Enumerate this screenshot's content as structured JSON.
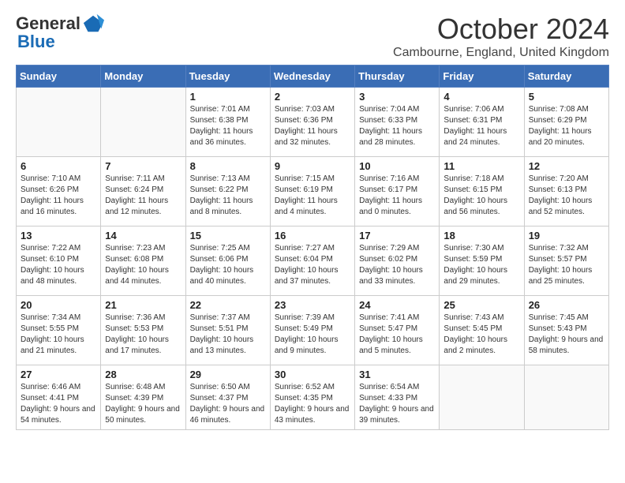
{
  "logo": {
    "general": "General",
    "blue": "Blue"
  },
  "header": {
    "month_year": "October 2024",
    "location": "Cambourne, England, United Kingdom"
  },
  "days_of_week": [
    "Sunday",
    "Monday",
    "Tuesday",
    "Wednesday",
    "Thursday",
    "Friday",
    "Saturday"
  ],
  "weeks": [
    [
      {
        "day": "",
        "info": ""
      },
      {
        "day": "",
        "info": ""
      },
      {
        "day": "1",
        "info": "Sunrise: 7:01 AM\nSunset: 6:38 PM\nDaylight: 11 hours and 36 minutes."
      },
      {
        "day": "2",
        "info": "Sunrise: 7:03 AM\nSunset: 6:36 PM\nDaylight: 11 hours and 32 minutes."
      },
      {
        "day": "3",
        "info": "Sunrise: 7:04 AM\nSunset: 6:33 PM\nDaylight: 11 hours and 28 minutes."
      },
      {
        "day": "4",
        "info": "Sunrise: 7:06 AM\nSunset: 6:31 PM\nDaylight: 11 hours and 24 minutes."
      },
      {
        "day": "5",
        "info": "Sunrise: 7:08 AM\nSunset: 6:29 PM\nDaylight: 11 hours and 20 minutes."
      }
    ],
    [
      {
        "day": "6",
        "info": "Sunrise: 7:10 AM\nSunset: 6:26 PM\nDaylight: 11 hours and 16 minutes."
      },
      {
        "day": "7",
        "info": "Sunrise: 7:11 AM\nSunset: 6:24 PM\nDaylight: 11 hours and 12 minutes."
      },
      {
        "day": "8",
        "info": "Sunrise: 7:13 AM\nSunset: 6:22 PM\nDaylight: 11 hours and 8 minutes."
      },
      {
        "day": "9",
        "info": "Sunrise: 7:15 AM\nSunset: 6:19 PM\nDaylight: 11 hours and 4 minutes."
      },
      {
        "day": "10",
        "info": "Sunrise: 7:16 AM\nSunset: 6:17 PM\nDaylight: 11 hours and 0 minutes."
      },
      {
        "day": "11",
        "info": "Sunrise: 7:18 AM\nSunset: 6:15 PM\nDaylight: 10 hours and 56 minutes."
      },
      {
        "day": "12",
        "info": "Sunrise: 7:20 AM\nSunset: 6:13 PM\nDaylight: 10 hours and 52 minutes."
      }
    ],
    [
      {
        "day": "13",
        "info": "Sunrise: 7:22 AM\nSunset: 6:10 PM\nDaylight: 10 hours and 48 minutes."
      },
      {
        "day": "14",
        "info": "Sunrise: 7:23 AM\nSunset: 6:08 PM\nDaylight: 10 hours and 44 minutes."
      },
      {
        "day": "15",
        "info": "Sunrise: 7:25 AM\nSunset: 6:06 PM\nDaylight: 10 hours and 40 minutes."
      },
      {
        "day": "16",
        "info": "Sunrise: 7:27 AM\nSunset: 6:04 PM\nDaylight: 10 hours and 37 minutes."
      },
      {
        "day": "17",
        "info": "Sunrise: 7:29 AM\nSunset: 6:02 PM\nDaylight: 10 hours and 33 minutes."
      },
      {
        "day": "18",
        "info": "Sunrise: 7:30 AM\nSunset: 5:59 PM\nDaylight: 10 hours and 29 minutes."
      },
      {
        "day": "19",
        "info": "Sunrise: 7:32 AM\nSunset: 5:57 PM\nDaylight: 10 hours and 25 minutes."
      }
    ],
    [
      {
        "day": "20",
        "info": "Sunrise: 7:34 AM\nSunset: 5:55 PM\nDaylight: 10 hours and 21 minutes."
      },
      {
        "day": "21",
        "info": "Sunrise: 7:36 AM\nSunset: 5:53 PM\nDaylight: 10 hours and 17 minutes."
      },
      {
        "day": "22",
        "info": "Sunrise: 7:37 AM\nSunset: 5:51 PM\nDaylight: 10 hours and 13 minutes."
      },
      {
        "day": "23",
        "info": "Sunrise: 7:39 AM\nSunset: 5:49 PM\nDaylight: 10 hours and 9 minutes."
      },
      {
        "day": "24",
        "info": "Sunrise: 7:41 AM\nSunset: 5:47 PM\nDaylight: 10 hours and 5 minutes."
      },
      {
        "day": "25",
        "info": "Sunrise: 7:43 AM\nSunset: 5:45 PM\nDaylight: 10 hours and 2 minutes."
      },
      {
        "day": "26",
        "info": "Sunrise: 7:45 AM\nSunset: 5:43 PM\nDaylight: 9 hours and 58 minutes."
      }
    ],
    [
      {
        "day": "27",
        "info": "Sunrise: 6:46 AM\nSunset: 4:41 PM\nDaylight: 9 hours and 54 minutes."
      },
      {
        "day": "28",
        "info": "Sunrise: 6:48 AM\nSunset: 4:39 PM\nDaylight: 9 hours and 50 minutes."
      },
      {
        "day": "29",
        "info": "Sunrise: 6:50 AM\nSunset: 4:37 PM\nDaylight: 9 hours and 46 minutes."
      },
      {
        "day": "30",
        "info": "Sunrise: 6:52 AM\nSunset: 4:35 PM\nDaylight: 9 hours and 43 minutes."
      },
      {
        "day": "31",
        "info": "Sunrise: 6:54 AM\nSunset: 4:33 PM\nDaylight: 9 hours and 39 minutes."
      },
      {
        "day": "",
        "info": ""
      },
      {
        "day": "",
        "info": ""
      }
    ]
  ]
}
